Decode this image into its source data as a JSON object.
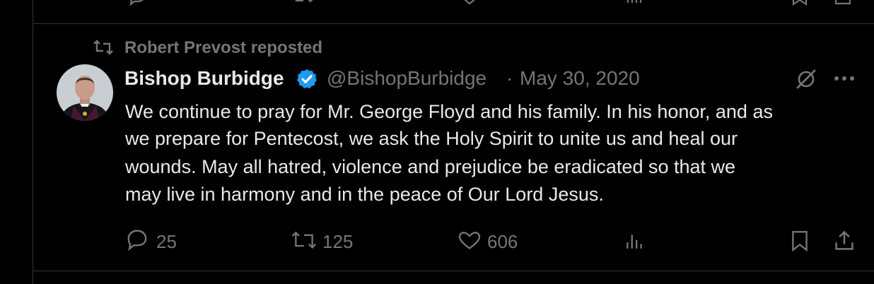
{
  "colors": {
    "background": "#000000",
    "text_primary": "#e7e9ea",
    "text_secondary": "#71767b",
    "divider": "#2f3336",
    "verified_badge": "#1d9bf0"
  },
  "prev_tweet_actions": {
    "icons": [
      "reply-icon",
      "retweet-icon",
      "like-icon",
      "views-icon",
      "bookmark-icon",
      "share-icon"
    ]
  },
  "tweet": {
    "repost_context": {
      "icon": "retweet-icon",
      "text": "Robert Prevost reposted"
    },
    "author": {
      "display_name": "Bishop Burbidge",
      "verified": true,
      "handle": "@BishopBurbidge",
      "separator": "·",
      "date": "May 30, 2020",
      "avatar_icon": "bishop-portrait"
    },
    "header_icons": [
      "grok-icon",
      "more-icon"
    ],
    "body_lines": [
      "We continue to pray for Mr. George Floyd and his family. In his honor, and as",
      "we prepare for Pentecost, we ask the Holy Spirit to unite us and heal our",
      "wounds. May all hatred, violence and prejudice be eradicated so that we",
      "may live in harmony and in the peace of Our Lord Jesus."
    ],
    "actions": {
      "replies": "25",
      "reposts": "125",
      "likes": "606"
    }
  }
}
